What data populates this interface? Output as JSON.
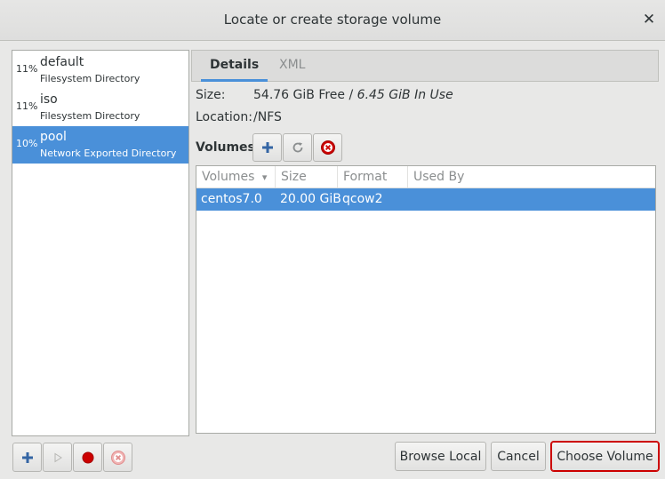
{
  "window": {
    "title": "Locate or create storage volume",
    "close_glyph": "✕"
  },
  "pools": [
    {
      "usage": "11%",
      "name": "default",
      "type": "Filesystem Directory",
      "selected": false
    },
    {
      "usage": "11%",
      "name": "iso",
      "type": "Filesystem Directory",
      "selected": false
    },
    {
      "usage": "10%",
      "name": "pool",
      "type": "Network Exported Directory",
      "selected": true
    }
  ],
  "tabs": [
    {
      "label": "Details",
      "active": true
    },
    {
      "label": "XML",
      "active": false
    }
  ],
  "details": {
    "size_label": "Size:",
    "size_free": "54.76 GiB Free / ",
    "size_in_use": "6.45 GiB In Use",
    "location_label": "Location:",
    "location_value": "/NFS",
    "volumes_label": "Volumes"
  },
  "volume_toolbar": {
    "add_icon": "add-icon",
    "refresh_icon": "refresh-icon",
    "delete_icon": "delete-icon"
  },
  "volumes_table": {
    "columns": [
      "Volumes",
      "Size",
      "Format",
      "Used By"
    ],
    "sort_indicator": "▾",
    "rows": [
      {
        "name": "centos7.0",
        "size": "20.00 GiB",
        "format": "qcow2",
        "used_by": "",
        "selected": true
      }
    ]
  },
  "pool_toolbar": {
    "add_icon": "add-icon",
    "start_icon": "play-icon",
    "stop_icon": "stop-icon",
    "delete_icon": "delete-icon"
  },
  "buttons": {
    "browse_local": "Browse Local",
    "cancel": "Cancel",
    "choose_volume": "Choose Volume"
  },
  "colors": {
    "selection": "#4a90d9",
    "accent_red": "#cc0000"
  }
}
